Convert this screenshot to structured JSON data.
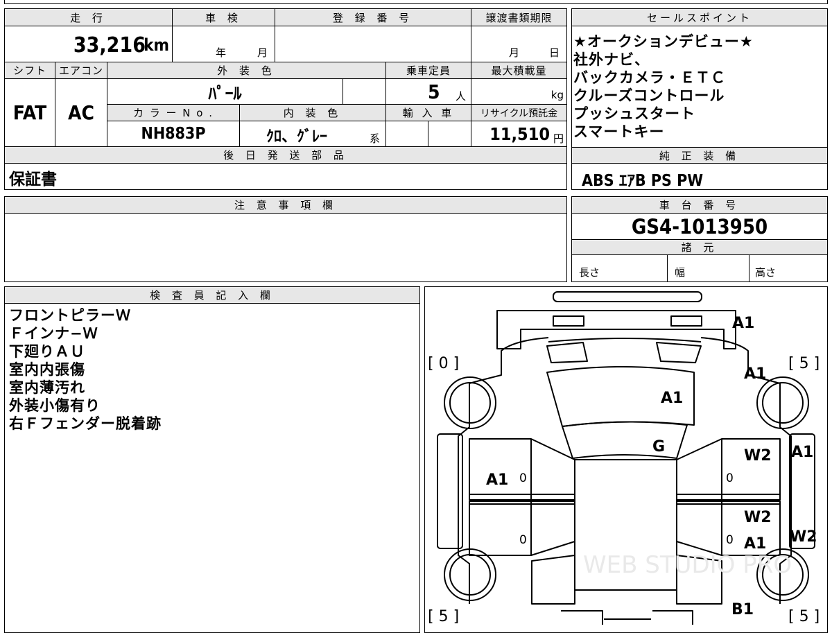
{
  "mileage": {
    "label": "走 行",
    "value": "33,216",
    "unit": "km"
  },
  "inspection": {
    "label": "車 検",
    "year_unit": "年",
    "month_unit": "月"
  },
  "registration_number": {
    "label": "登 録 番 号",
    "value": ""
  },
  "transfer_deadline": {
    "label": "譲渡書類期限",
    "month_unit": "月",
    "day_unit": "日"
  },
  "shift": {
    "label": "シフト",
    "value": "FAT"
  },
  "aircon": {
    "label": "エアコン",
    "value": "AC"
  },
  "exterior_color": {
    "label": "外 装 色",
    "value": "ﾊﾟｰﾙ"
  },
  "capacity": {
    "label": "乗車定員",
    "value": "5",
    "unit": "人"
  },
  "max_load": {
    "label": "最大積載量",
    "unit": "kg"
  },
  "color_no": {
    "label": "カ ラ ー N o .",
    "value": "NH883P"
  },
  "interior_color": {
    "label": "内 装 色",
    "value": "ｸﾛ、ｸﾞﾚｰ",
    "suffix": "系"
  },
  "import": {
    "label": "輸 入 車"
  },
  "recycle": {
    "label": "リサイクル預託金",
    "value": "11,510",
    "unit": "円"
  },
  "later_parts": {
    "label": "後 日 発 送 部 品",
    "value": "保証書"
  },
  "sales_points": {
    "label": "セールスポイント",
    "items": [
      "★オークションデビュー★",
      "社外ナビ、",
      "バックカメラ・ＥＴＣ",
      "クルーズコントロール",
      "プッシュスタート",
      "スマートキー"
    ]
  },
  "genuine_equipment": {
    "label": "純 正 装 備",
    "value": "ABS ｴｱB PS PW"
  },
  "notes": {
    "label": "注 意 事 項 欄",
    "value": ""
  },
  "chassis": {
    "label": "車 台 番 号",
    "value": "GS4-1013950"
  },
  "specs": {
    "label": "諸 元",
    "length": "長さ",
    "width": "幅",
    "height": "高さ"
  },
  "inspector": {
    "label": "検 査 員 記 入 欄",
    "items": [
      "フロントピラーＷ",
      "Ｆインナ−Ｗ",
      "下廻りＡＵ",
      "室内内張傷",
      "室内薄汚れ",
      "外装小傷有り",
      "右Ｆフェンダー脱着跡"
    ]
  },
  "diagram": {
    "tread_fl": "[ 0 ]",
    "tread_fr": "[ 5 ]",
    "tread_rl": "[ 5 ]",
    "tread_rr": "[ 5 ]",
    "marks": {
      "front_bumper": "A1",
      "hood_right": "A1",
      "hood": "A1",
      "windshield": "G",
      "front_right_door": "W2",
      "rear_right_door": "W2",
      "right_pillar": "A1",
      "right_rocker": "W2",
      "left_door": "A1",
      "rear_right_area": "A1",
      "rear_bumper": "B1"
    },
    "zero_1": "0",
    "zero_2": "0",
    "zero_3": "0",
    "zero_4": "0",
    "watermark": "WEB STUDIO PRO"
  }
}
